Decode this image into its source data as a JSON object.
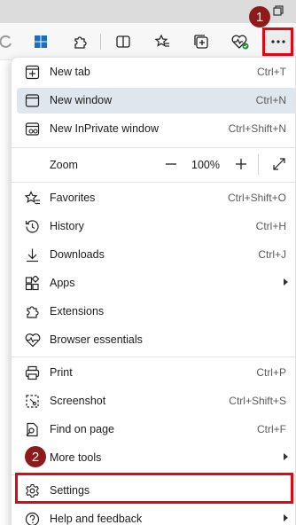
{
  "callouts": {
    "step1": "1",
    "step2": "2"
  },
  "menu": {
    "items": [
      {
        "name": "new-tab",
        "label": "New tab",
        "shortcut": "Ctrl+T"
      },
      {
        "name": "new-window",
        "label": "New window",
        "shortcut": "Ctrl+N",
        "highlighted": true
      },
      {
        "name": "new-inprivate-window",
        "label": "New InPrivate window",
        "shortcut": "Ctrl+Shift+N"
      },
      {
        "name": "favorites",
        "label": "Favorites",
        "shortcut": "Ctrl+Shift+O"
      },
      {
        "name": "history",
        "label": "History",
        "shortcut": "Ctrl+H"
      },
      {
        "name": "downloads",
        "label": "Downloads",
        "shortcut": "Ctrl+J"
      },
      {
        "name": "apps",
        "label": "Apps",
        "submenu": true
      },
      {
        "name": "extensions",
        "label": "Extensions"
      },
      {
        "name": "browser-essentials",
        "label": "Browser essentials"
      },
      {
        "name": "print",
        "label": "Print",
        "shortcut": "Ctrl+P"
      },
      {
        "name": "screenshot",
        "label": "Screenshot",
        "shortcut": "Ctrl+Shift+S"
      },
      {
        "name": "find-on-page",
        "label": "Find on page",
        "shortcut": "Ctrl+F"
      },
      {
        "name": "more-tools",
        "label": "More tools",
        "submenu": true
      },
      {
        "name": "settings",
        "label": "Settings"
      },
      {
        "name": "help-and-feedback",
        "label": "Help and feedback",
        "submenu": true
      }
    ],
    "zoom": {
      "label": "Zoom",
      "value": "100%"
    }
  },
  "colors": {
    "annotation_red": "#e30613",
    "badge": "#8e1b1b",
    "highlight": "#dfe6ee"
  }
}
